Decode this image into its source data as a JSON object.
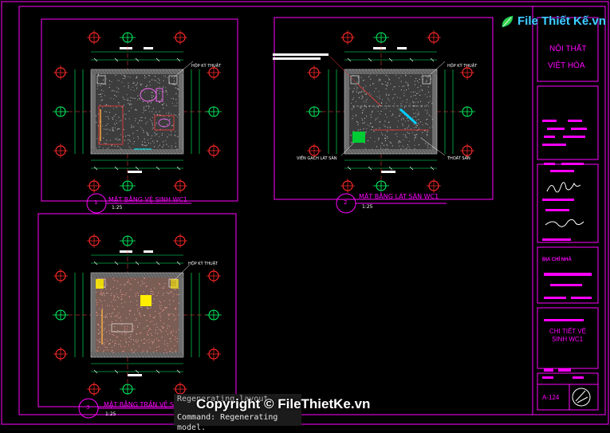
{
  "titleblock": {
    "company_line1": "NỘI THẤT",
    "company_line2": "VIỆT HÒA",
    "owner_label": "ĐỊA CHỈ NHÀ",
    "drawing_title_line1": "CHI TIẾT VỆ",
    "drawing_title_line2": "SINH WC1",
    "sheet_number": "A-124"
  },
  "views": [
    {
      "title": "MẶT BẰNG VỆ SINH WC1",
      "scale": "1:25",
      "number": "1"
    },
    {
      "title": "MẶT BẰNG LÁT SÀN WC1",
      "scale": "1:25",
      "number": "2"
    },
    {
      "title": "MẶT BẰNG TRẦN VỆ SINH WC1",
      "scale": "1:25",
      "number": "3"
    }
  ],
  "labels": {
    "hop_ky_thuat": "HỘP KỸ THUẬT",
    "vien_gach": "VIỀN GẠCH LÁT SÀN",
    "thoat_san": "THOÁT SÀN"
  },
  "command_line": {
    "line1": "Regenerating layout.",
    "line2": "Command: Regenerating model."
  },
  "watermark": {
    "copyright": "Copyright © FileThietKe.vn",
    "brand": "File Thiết Kế.vn"
  },
  "colors": {
    "frame": "#ff00ff",
    "wall": "#808080",
    "grid_bubble": "#ff2a2a",
    "dimension": "#00ff66",
    "floor_fill": "#a89080",
    "background": "#000000"
  }
}
